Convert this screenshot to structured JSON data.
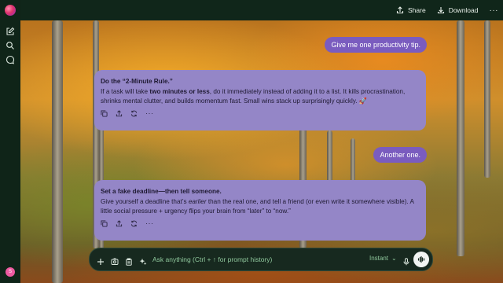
{
  "header": {
    "share_label": "Share",
    "download_label": "Download",
    "more_label": "···"
  },
  "sidebar": {
    "avatar_initials": "S",
    "icons": [
      "new-chat-icon",
      "search-icon",
      "chat-icon"
    ]
  },
  "messages": [
    {
      "role": "user",
      "text": "Give me one productivity tip."
    },
    {
      "role": "assistant",
      "title": "Do the “2-Minute Rule.”",
      "body_pre": "If a task will take ",
      "body_bold": "two minutes or less",
      "body_post": ", do it immediately instead of adding it to a list. It kills procrastination, shrinks mental clutter, and builds momentum fast. Small wins stack up surprisingly quickly. 🚀"
    },
    {
      "role": "user",
      "text": "Another one."
    },
    {
      "role": "assistant",
      "title": "Set a fake deadline—then tell someone.",
      "body_pre": "Give yourself a deadline that’s ",
      "body_italic": "earlier",
      "body_post": " than the real one, and tell a friend (or even write it somewhere visible). A little social pressure + urgency flips your brain from “later” to “now.”"
    }
  ],
  "composer": {
    "placeholder": "Ask anything (Ctrl + ↑ for prompt history)",
    "mode_label": "Instant",
    "mode_chevron": "⌄",
    "more_dots": "···"
  },
  "colors": {
    "user_bubble": "#7a5cbf",
    "assistant_card": "#9486c7",
    "composer_text": "#8fc79c",
    "topbar": "#10261a"
  }
}
